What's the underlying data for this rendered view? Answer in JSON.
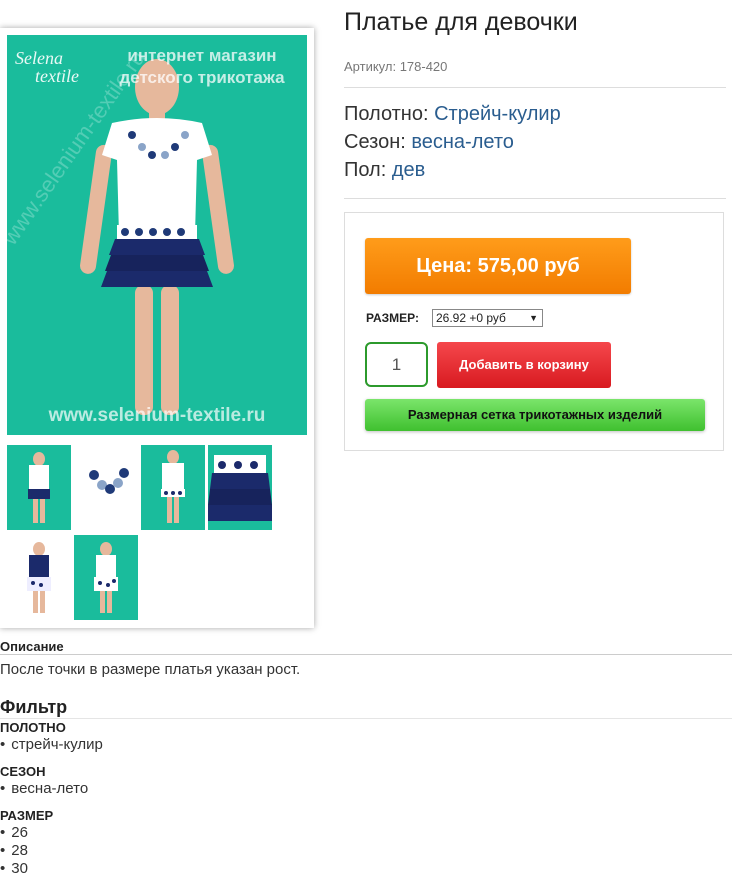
{
  "product": {
    "title": "Платье для девочки",
    "sku": "Артикул: 178-420",
    "props": [
      {
        "label": "Полотно:",
        "value": "Стрейч-кулир"
      },
      {
        "label": "Сезон:",
        "value": "весна-лето"
      },
      {
        "label": "Пол:",
        "value": "дев"
      }
    ]
  },
  "image": {
    "logo_line1": "Selena",
    "logo_line2": "textile",
    "watermark_line1": "интернет магазин",
    "watermark_line2": "детского трикотажа",
    "watermark_url": "www.selenium-textile.ru",
    "watermark_diag": "www.selenium-textile.ru"
  },
  "buy": {
    "price_label": "Цена: 575,00 руб",
    "size_label": "РАЗМЕР:",
    "size_value": "26.92 +0 руб",
    "quantity": "1",
    "add_to_cart": "Добавить в корзину",
    "size_chart": "Размерная сетка трикотажных изделий"
  },
  "description": {
    "heading": "Описание",
    "text": "После точки в размере платья указан рост."
  },
  "filter": {
    "heading": "Фильтр",
    "groups": [
      {
        "name": "ПОЛОТНО",
        "items": [
          "стрейч-кулир"
        ]
      },
      {
        "name": "СЕЗОН",
        "items": [
          "весна-лето"
        ]
      },
      {
        "name": "РАЗМЕР",
        "items": [
          "26",
          "28",
          "30"
        ]
      }
    ]
  }
}
